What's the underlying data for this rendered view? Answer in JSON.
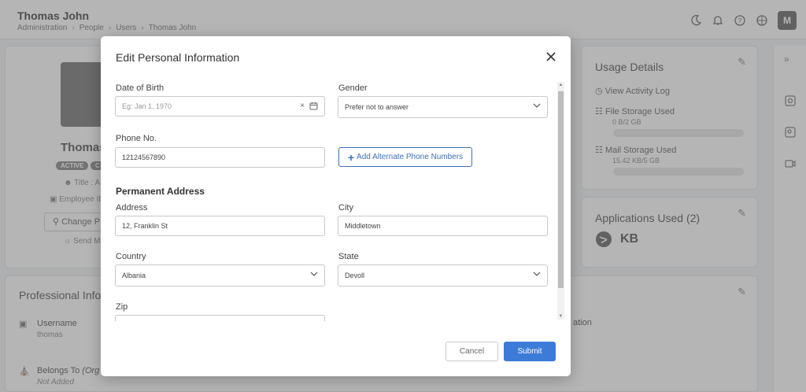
{
  "page": {
    "title": "Thomas John",
    "breadcrumb": [
      "Administration",
      "People",
      "Users",
      "Thomas John"
    ],
    "avatar_letter": "M"
  },
  "profile": {
    "name": "Thomas",
    "badges": [
      "ACTIVE",
      "C"
    ],
    "title_line": "Title : A",
    "employee_line": "Employee ID",
    "change_button": "Change P",
    "send_line": "Send M"
  },
  "usage": {
    "title": "Usage Details",
    "activity_log": "View Activity Log",
    "file_storage": {
      "label": "File Storage Used",
      "value": "0 B/2 GB",
      "fraction": 0
    },
    "mail_storage": {
      "label": "Mail Storage Used",
      "value": "15.42 KB/5 GB",
      "fraction": 3e-06
    }
  },
  "apps": {
    "title": "Applications Used (2)",
    "kb_label": "KB"
  },
  "professional": {
    "title": "Professional Info",
    "username_label": "Username",
    "username_value": "thomas",
    "belongs_label": "Belongs To",
    "belongs_label_italic": "(Org",
    "belongs_value": "Not Added",
    "ation_text": "ation"
  },
  "modal": {
    "title": "Edit Personal Information",
    "dob": {
      "label": "Date of Birth",
      "placeholder": "Eg: Jan 1, 1970"
    },
    "gender": {
      "label": "Gender",
      "value": "Prefer not to answer"
    },
    "phone": {
      "label": "Phone No.",
      "value": "12124567890"
    },
    "alt_phone_button": "Add Alternate Phone Numbers",
    "section_title": "Permanent Address",
    "address": {
      "label": "Address",
      "value": "12, Franklin St"
    },
    "city": {
      "label": "City",
      "value": "Middletown"
    },
    "country": {
      "label": "Country",
      "value": "Albania"
    },
    "state": {
      "label": "State",
      "value": "Devoll"
    },
    "zip": {
      "label": "Zip",
      "value": ""
    },
    "cancel_button": "Cancel",
    "submit_button": "Submit"
  }
}
